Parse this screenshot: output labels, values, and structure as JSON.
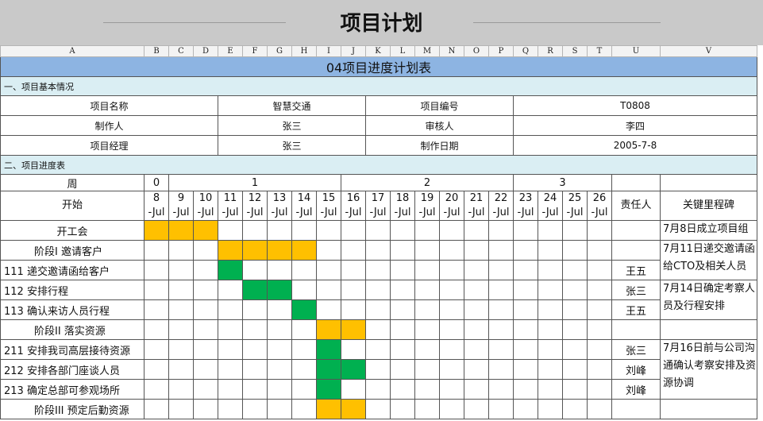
{
  "page_title": "项目计划",
  "columns": [
    "A",
    "B",
    "C",
    "D",
    "E",
    "F",
    "G",
    "H",
    "I",
    "J",
    "K",
    "L",
    "M",
    "N",
    "O",
    "P",
    "Q",
    "R",
    "S",
    "T",
    "U",
    "V"
  ],
  "sheet_title": "04项目进度计划表",
  "section1": "一、项目基本情况",
  "info": {
    "name_label": "项目名称",
    "name_value": "智慧交通",
    "code_label": "项目编号",
    "code_value": "T0808",
    "author_label": "制作人",
    "author_value": "张三",
    "reviewer_label": "审核人",
    "reviewer_value": "李四",
    "manager_label": "项目经理",
    "manager_value": "张三",
    "date_label": "制作日期",
    "date_value": "2005-7-8"
  },
  "section2": "二、项目进度表",
  "week_label": "周",
  "weeks": [
    "0",
    "1",
    "2",
    "3"
  ],
  "start_label": "开始",
  "days": [
    "8",
    "9",
    "10",
    "11",
    "12",
    "13",
    "14",
    "15",
    "16",
    "17",
    "18",
    "19",
    "20",
    "21",
    "22",
    "23",
    "24",
    "25",
    "26"
  ],
  "month_suffix": "-Jul",
  "owner_header": "责任人",
  "milestone_header": "关键里程碑",
  "tasks": [
    {
      "name": "开工会",
      "owner": ""
    },
    {
      "name": "阶段I  邀请客户",
      "owner": ""
    },
    {
      "name": "111  递交邀请函给客户",
      "owner": "王五"
    },
    {
      "name": "112  安排行程",
      "owner": "张三"
    },
    {
      "name": "113  确认来访人员行程",
      "owner": "王五"
    },
    {
      "name": "阶段II  落实资源",
      "owner": ""
    },
    {
      "name": "211  安排我司高层接待资源",
      "owner": "张三"
    },
    {
      "name": "212  安排各部门座谈人员",
      "owner": "刘峰"
    },
    {
      "name": "213  确定总部可参观场所",
      "owner": "刘峰"
    },
    {
      "name": "阶段III  预定后勤资源",
      "owner": ""
    }
  ],
  "milestones": {
    "m1": "7月8日成立项目组",
    "m2": "7月11日递交邀请函给CTO及相关人员",
    "m3": "7月14日确定考察人员及行程安排",
    "m4": "7月16日前与公司沟通确认考察安排及资源协调"
  },
  "colors": {
    "phase": "#ffc000",
    "task": "#00b050",
    "title_bg": "#8db4e2",
    "section_bg": "#daeef3"
  }
}
